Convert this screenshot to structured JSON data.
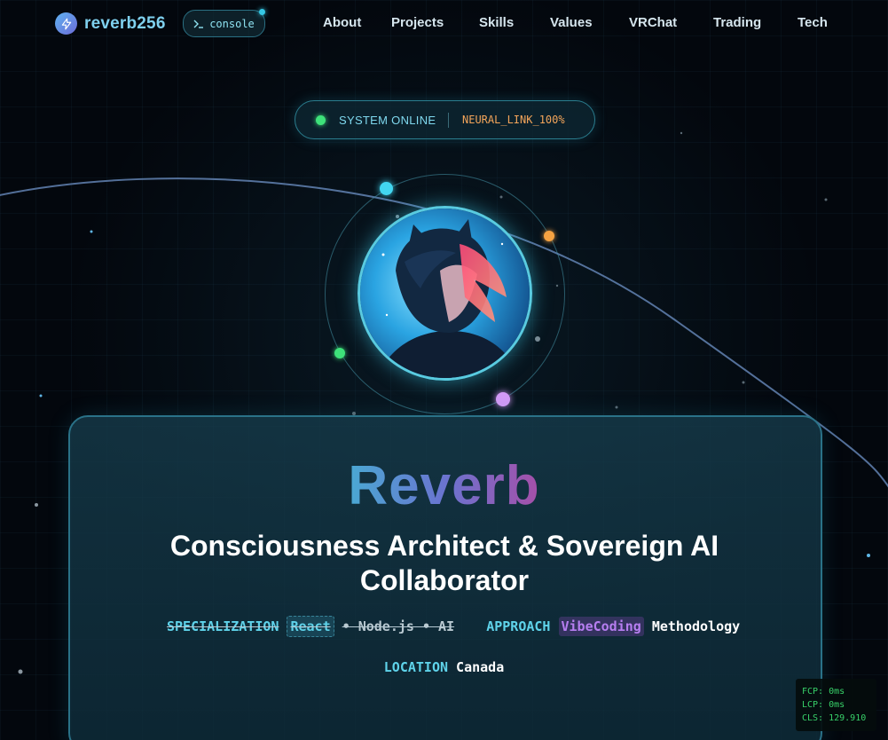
{
  "nav": {
    "brand": "reverb256",
    "console_label": "console",
    "links": [
      "About",
      "Projects",
      "Skills",
      "Values",
      "VRChat",
      "Trading",
      "Tech"
    ]
  },
  "status": {
    "state": "SYSTEM ONLINE",
    "link": "NEURAL_LINK_100%"
  },
  "hero": {
    "name": "Reverb",
    "tagline": "Consciousness Architect & Sovereign AI Collaborator",
    "specialization_label": "SPECIALIZATION",
    "specialization_tag": "React",
    "specialization_rest": "• Node.js • AI",
    "approach_label": "APPROACH",
    "approach_tag": "VibeCoding",
    "approach_rest": "Methodology",
    "location_label": "LOCATION",
    "location_value": "Canada"
  },
  "perf": {
    "fcp": "FCP: 0ms",
    "lcp": "LCP: 0ms",
    "cls": "CLS: 129.910"
  },
  "colors": {
    "accent_cyan": "#5fd3ea",
    "status_green": "#3ee27a",
    "neural_orange": "#f4a55a",
    "vibe_purple": "#b67ef0"
  }
}
